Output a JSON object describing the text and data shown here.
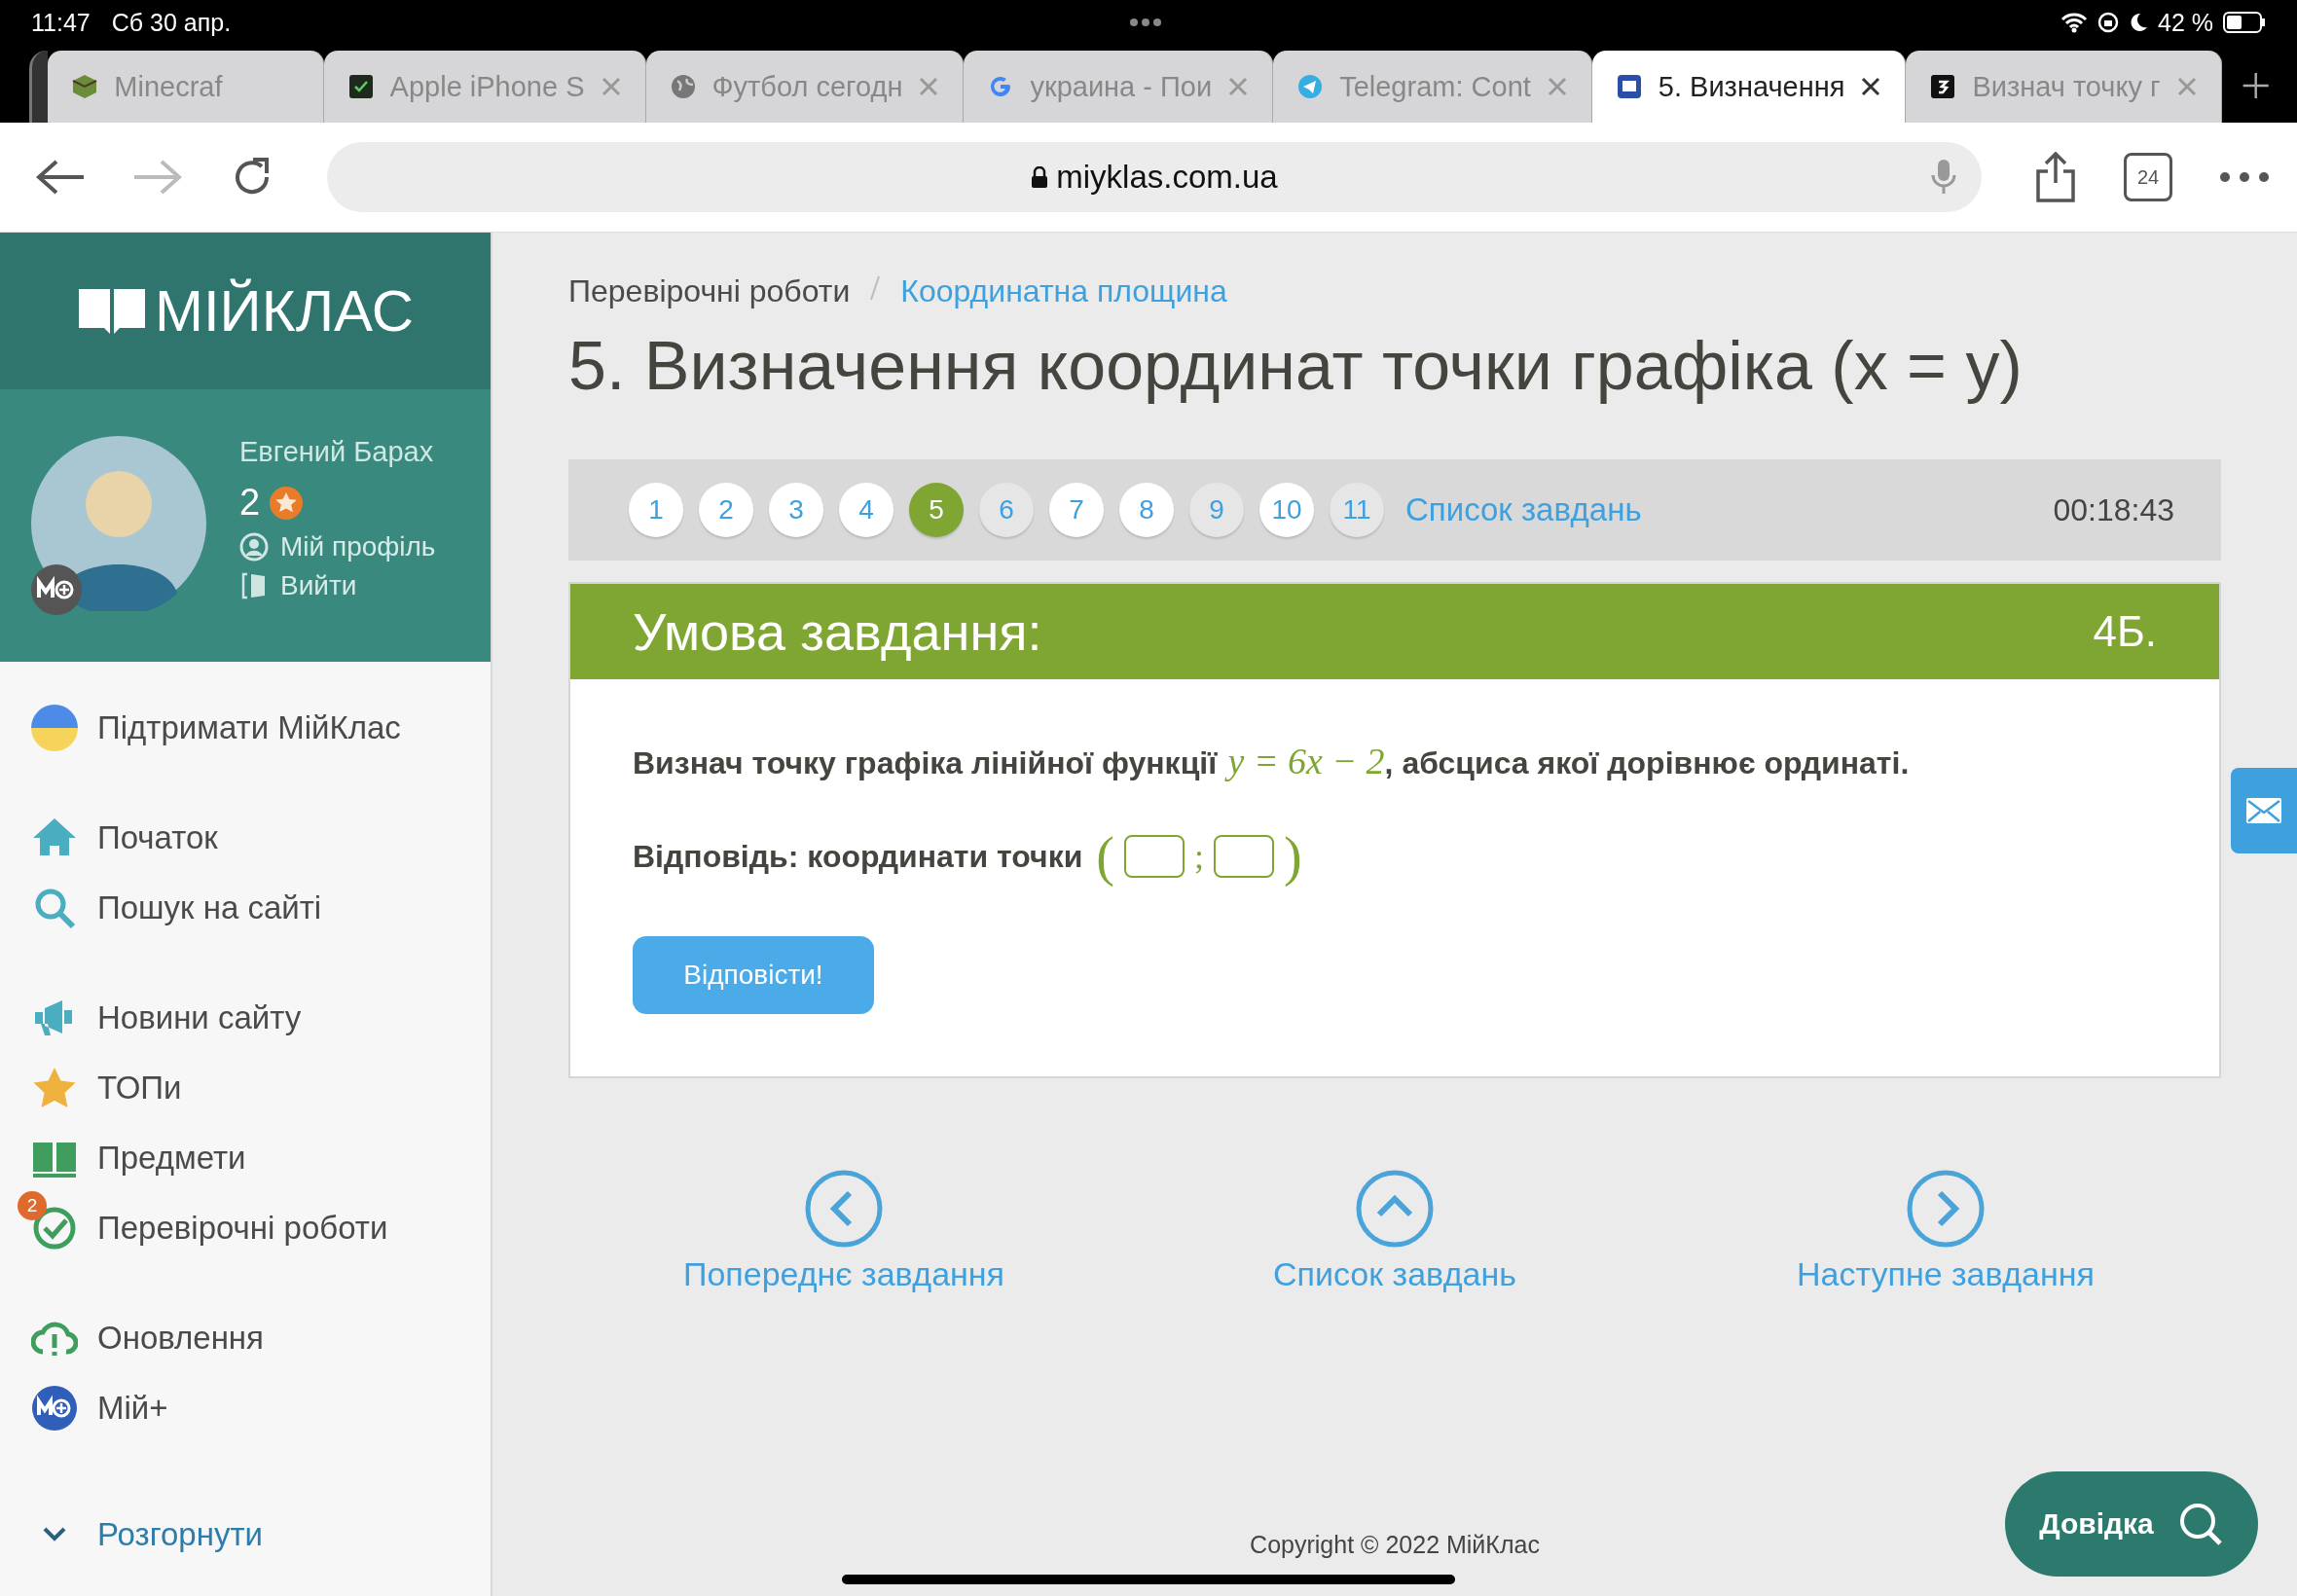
{
  "status_bar": {
    "time": "11:47",
    "date": "Сб 30 апр.",
    "battery": "42 %"
  },
  "browser": {
    "tabs": [
      {
        "title": "Minecraf",
        "selected": false,
        "closable": false
      },
      {
        "title": "Apple iPhone S",
        "selected": false,
        "closable": true
      },
      {
        "title": "Футбол сегодн",
        "selected": false,
        "closable": true
      },
      {
        "title": "украина - Пои",
        "selected": false,
        "closable": true
      },
      {
        "title": "Telegram: Cont",
        "selected": false,
        "closable": true
      },
      {
        "title": "5. Визначення",
        "selected": true,
        "closable": true
      },
      {
        "title": "Визнач точку г",
        "selected": false,
        "closable": true
      }
    ],
    "url": "miyklas.com.ua",
    "tab_count": "24"
  },
  "sidebar": {
    "logo": "МІЙКЛАС",
    "user": {
      "name": "Евгений Барах",
      "points": "2"
    },
    "profile_links": [
      "Мій профіль",
      "Вийти"
    ],
    "menu_groups": [
      [
        {
          "label": "Підтримати МійКлас"
        }
      ],
      [
        {
          "label": "Початок"
        },
        {
          "label": "Пошук на сайті"
        }
      ],
      [
        {
          "label": "Новини сайту"
        },
        {
          "label": "ТОПи"
        },
        {
          "label": "Предмети"
        },
        {
          "label": "Перевірочні роботи",
          "badge": "2"
        }
      ],
      [
        {
          "label": "Оновлення"
        },
        {
          "label": "Мій+"
        }
      ]
    ],
    "expand": "Розгорнути"
  },
  "breadcrumb": [
    {
      "label": "Перевірочні роботи",
      "link": false
    },
    {
      "label": "Координатна площина",
      "link": true
    }
  ],
  "title": "5. Визначення координат точки графіка (x = y)",
  "task_nav": {
    "questions": [
      {
        "label": "1",
        "selected": false,
        "answered": true
      },
      {
        "label": "2",
        "selected": false,
        "answered": true
      },
      {
        "label": "3",
        "selected": false,
        "answered": true
      },
      {
        "label": "4",
        "selected": false,
        "answered": true
      },
      {
        "label": "5",
        "selected": true,
        "answered": false
      },
      {
        "label": "6",
        "selected": false,
        "answered": false
      },
      {
        "label": "7",
        "selected": false,
        "answered": true
      },
      {
        "label": "8",
        "selected": false,
        "answered": true
      },
      {
        "label": "9",
        "selected": false,
        "answered": false
      },
      {
        "label": "10",
        "selected": false,
        "answered": true
      },
      {
        "label": "11",
        "selected": false,
        "answered": false
      }
    ],
    "list_link": "Список завдань",
    "timer": "00:18:43"
  },
  "task": {
    "header": "Умова завдання:",
    "points": "4Б.",
    "question": [
      {
        "kind": "text",
        "text": "Визнач точку графіка лінійної функції"
      },
      {
        "kind": "math",
        "text": "y = 6x − 2"
      },
      {
        "kind": "text",
        "text": ", абсциса якої дорівнює ординаті."
      }
    ],
    "answer": {
      "label": "Відповідь: координати точки",
      "open": "(",
      "separator": ";",
      "close": ")"
    },
    "submit": "Відповісти!"
  },
  "footer_nav": [
    {
      "kind": "prev",
      "label": "Попереднє завдання"
    },
    {
      "kind": "list",
      "label": "Список завдань"
    },
    {
      "kind": "next",
      "label": "Наступне завдання"
    }
  ],
  "copyright": "Copyright © 2022 МійКлас",
  "help_button": "Довідка"
}
